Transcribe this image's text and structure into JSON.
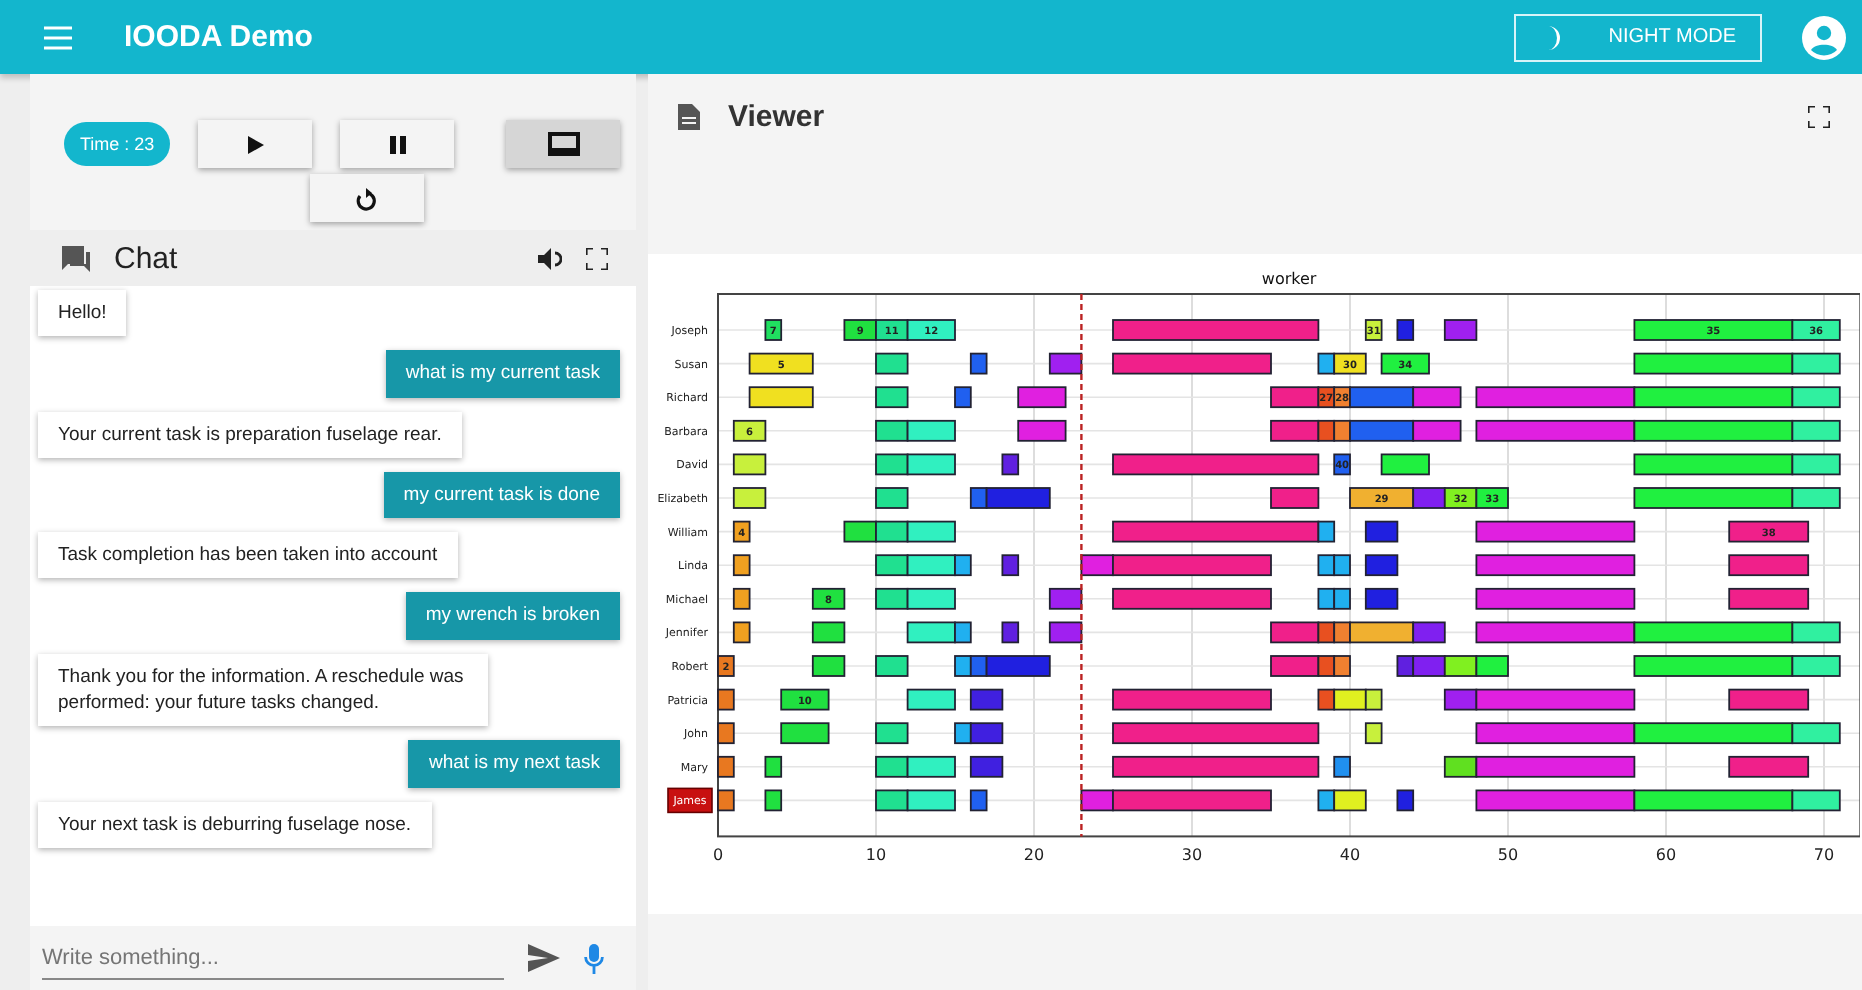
{
  "app_bar": {
    "title": "IOODA Demo",
    "night_mode_button": "NIGHT MODE"
  },
  "controls": {
    "time": "Time : 23",
    "screen_pressed": true
  },
  "chat": {
    "title": "Chat",
    "messages": [
      {
        "kind": "received",
        "text": "Hello!"
      },
      {
        "kind": "sent",
        "text": "what is my current task"
      },
      {
        "kind": "received",
        "text": "Your current task is preparation fuselage rear."
      },
      {
        "kind": "sent",
        "text": "my current task is done"
      },
      {
        "kind": "received",
        "text": "Task completion has been taken into account"
      },
      {
        "kind": "sent",
        "text": "my wrench is broken"
      },
      {
        "kind": "received",
        "text": "Thank you for the information. A reschedule was performed: your future tasks changed."
      },
      {
        "kind": "sent",
        "text": "what is my next task"
      },
      {
        "kind": "received",
        "text": "Your next task is deburring fuselage nose."
      }
    ],
    "input": {
      "placeholder": "Write something..."
    }
  },
  "viewer": {
    "title": "Viewer",
    "gantt": {
      "title": "worker",
      "axis_labels": [
        "0",
        "10",
        "20",
        "30",
        "40",
        "50",
        "60",
        "70"
      ],
      "workers": [
        {
          "name": "Joseph",
          "selected": false,
          "task_labels": [
            "7",
            "9",
            "11",
            "12",
            "31",
            "35",
            "36"
          ]
        },
        {
          "name": "Susan",
          "selected": false,
          "task_labels": [
            "5",
            "30",
            "34"
          ]
        },
        {
          "name": "Richard",
          "selected": false,
          "task_labels": [
            "27",
            "28"
          ]
        },
        {
          "name": "Barbara",
          "selected": false,
          "task_labels": [
            "6"
          ]
        },
        {
          "name": "David",
          "selected": false,
          "task_labels": [
            "40"
          ]
        },
        {
          "name": "Elizabeth",
          "selected": false,
          "task_labels": [
            "29",
            "32",
            "33"
          ]
        },
        {
          "name": "William",
          "selected": false,
          "task_labels": [
            "4",
            "38"
          ]
        },
        {
          "name": "Linda",
          "selected": false
        },
        {
          "name": "Michael",
          "selected": false,
          "task_labels": [
            "8"
          ]
        },
        {
          "name": "Jennifer",
          "selected": false
        },
        {
          "name": "Robert",
          "selected": false,
          "task_labels": [
            "2"
          ]
        },
        {
          "name": "Patricia",
          "selected": false,
          "task_labels": [
            "10"
          ]
        },
        {
          "name": "John",
          "selected": false
        },
        {
          "name": "Mary",
          "selected": false
        },
        {
          "name": "James",
          "selected": true
        }
      ]
    }
  }
}
